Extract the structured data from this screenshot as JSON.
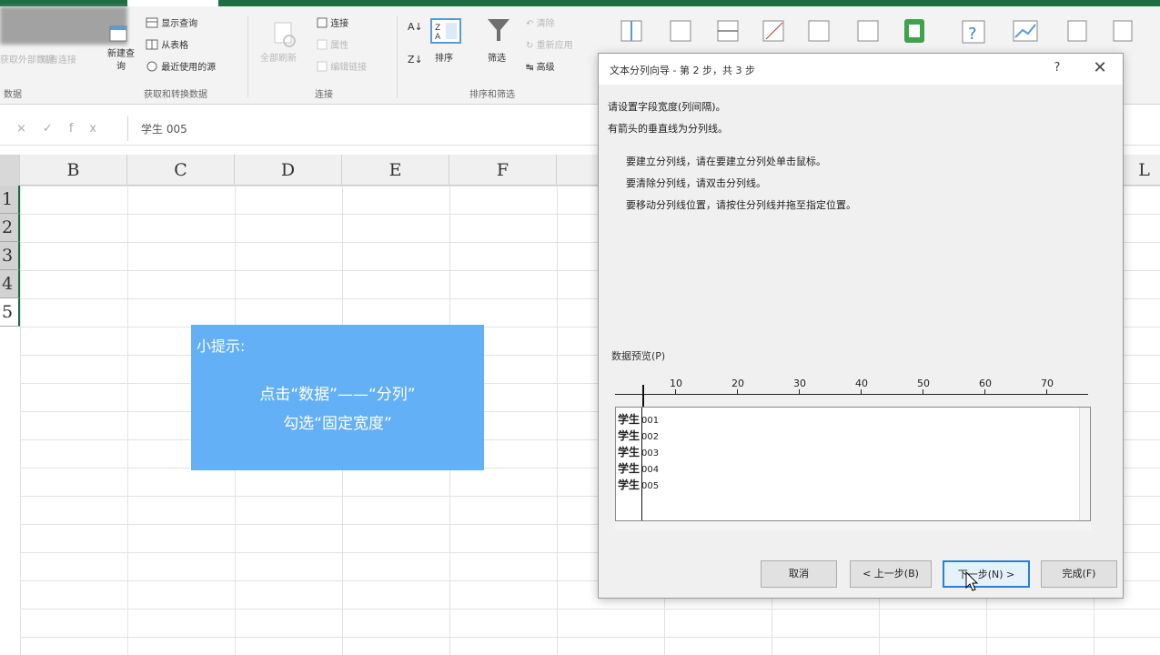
{
  "ribbon": {
    "groups": [
      {
        "label": "获取和转换数据",
        "buttons": [
          "显示查询",
          "从表格",
          "最近使用的源"
        ],
        "big_button": "新建查询"
      },
      {
        "label": "连接",
        "buttons": [
          "连接",
          "属性",
          "编辑链接"
        ],
        "big_button": "全部刷新"
      },
      {
        "label": "排序和筛选",
        "buttons": [
          "清除",
          "重新应用",
          "高级"
        ],
        "big_button": "筛选",
        "sort_label": "排序"
      }
    ],
    "left_labels": [
      "获取外部数据",
      "现有连接"
    ],
    "left_group": "数据"
  },
  "formula_bar": {
    "icons": [
      "×",
      "✓",
      "fx"
    ],
    "value": "学生 005"
  },
  "columns": [
    "B",
    "C",
    "D",
    "E",
    "F",
    "L"
  ],
  "rows": [
    "1",
    "2",
    "3",
    "4",
    "5"
  ],
  "tip": {
    "title": "小提示:",
    "line1": "点击“数据”——“分列”",
    "line2": "勾选“固定宽度”"
  },
  "dialog": {
    "title": "文本分列向导 - 第 2 步，共 3 步",
    "help": "?",
    "close": "✕",
    "intro": [
      "请设置字段宽度(列间隔)。",
      "有箭头的垂直线为分列线。"
    ],
    "instructions": [
      "要建立分列线，请在要建立分列处单击鼠标。",
      "要清除分列线，请双击分列线。",
      "要移动分列线位置，请按住分列线并拖至指定位置。"
    ],
    "preview_label": "数据预览(P)",
    "ruler_numbers": [
      "10",
      "20",
      "30",
      "40",
      "50",
      "60",
      "70"
    ],
    "preview_rows": [
      {
        "key": "学生",
        "value": "001"
      },
      {
        "key": "学生",
        "value": "002"
      },
      {
        "key": "学生",
        "value": "003"
      },
      {
        "key": "学生",
        "value": "004"
      },
      {
        "key": "学生",
        "value": "005"
      }
    ],
    "buttons": {
      "cancel": "取消",
      "back": "< 上一步(B)",
      "next": "下一步(N) >",
      "finish": "完成(F)"
    }
  }
}
